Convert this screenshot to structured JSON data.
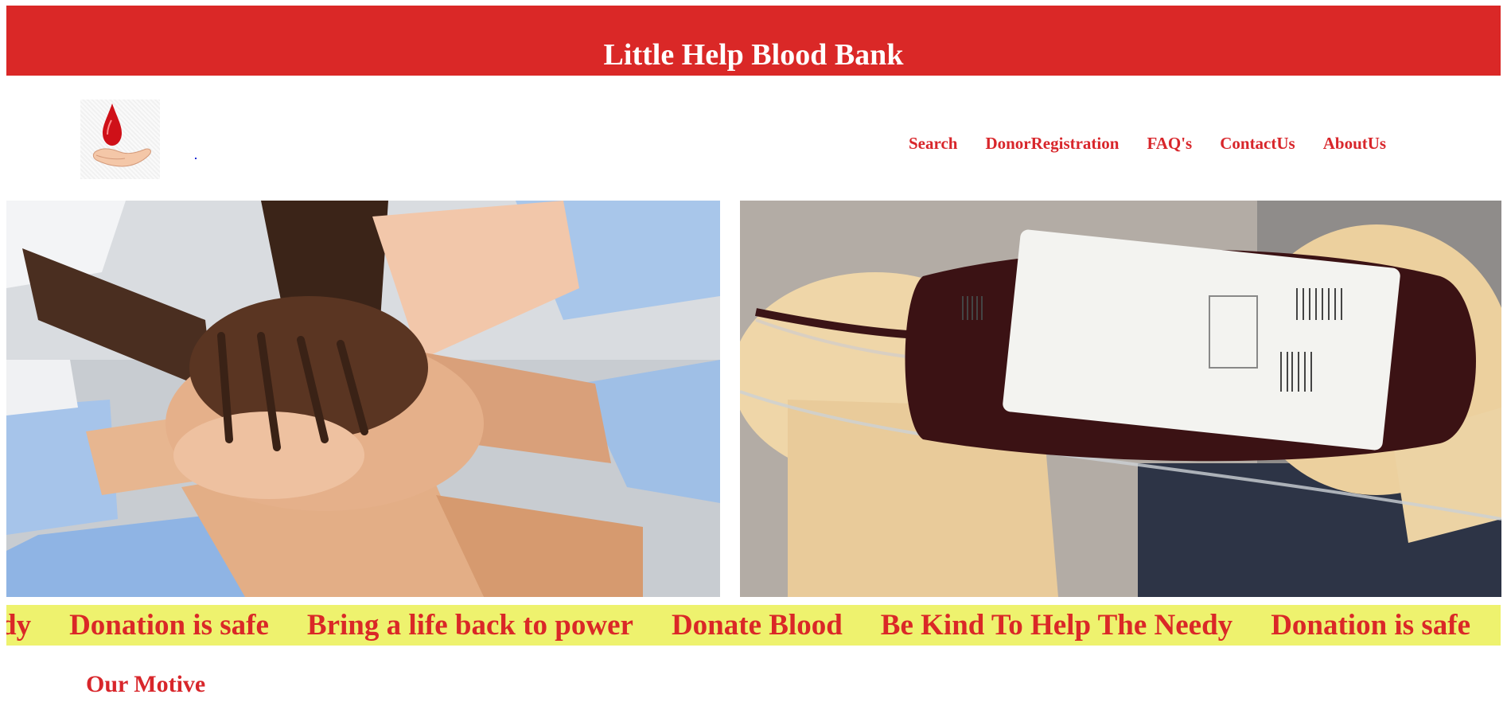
{
  "header": {
    "title": "Little Help Blood Bank"
  },
  "logo": {
    "icon": "blood-drop-hand-icon",
    "link_text": "."
  },
  "nav": {
    "items": [
      {
        "label": "Search"
      },
      {
        "label": "DonorRegistration"
      },
      {
        "label": "FAQ's"
      },
      {
        "label": "ContactUs"
      },
      {
        "label": "AboutUs"
      }
    ]
  },
  "images": {
    "left": {
      "icon": "stacked-hands-photo"
    },
    "right": {
      "icon": "blood-bag-photo"
    }
  },
  "ticker": {
    "items": [
      {
        "text": "dy"
      },
      {
        "text": "Donation is safe"
      },
      {
        "text": "Bring a life back to power"
      },
      {
        "text": "Donate Blood"
      },
      {
        "text": "Be Kind To Help The Needy"
      },
      {
        "text": "Donation is safe"
      }
    ]
  },
  "motive": {
    "title": "Our Motive"
  },
  "colors": {
    "brand_red": "#da2827",
    "ticker_bg": "#eef26e"
  }
}
